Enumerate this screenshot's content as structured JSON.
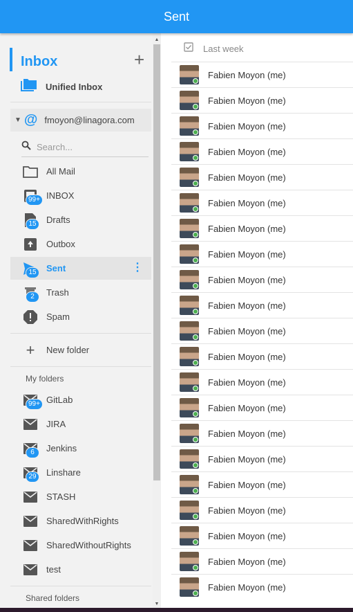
{
  "header": {
    "title": "Sent"
  },
  "sidebar": {
    "inbox_title": "Inbox",
    "unified_label": "Unified Inbox",
    "account_email": "fmoyon@linagora.com",
    "search_placeholder": "Search...",
    "folders": [
      {
        "label": "All Mail",
        "icon": "folder-icon",
        "badge": ""
      },
      {
        "label": "INBOX",
        "icon": "inbox-icon",
        "badge": "99+"
      },
      {
        "label": "Drafts",
        "icon": "drafts-icon",
        "badge": "15"
      },
      {
        "label": "Outbox",
        "icon": "outbox-icon",
        "badge": ""
      },
      {
        "label": "Sent",
        "icon": "send-icon",
        "badge": "15",
        "active": true
      },
      {
        "label": "Trash",
        "icon": "trash-icon",
        "badge": "2"
      },
      {
        "label": "Spam",
        "icon": "spam-icon",
        "badge": ""
      }
    ],
    "new_folder_label": "New folder",
    "my_folders_label": "My folders",
    "my_folders": [
      {
        "label": "GitLab",
        "badge": "99+"
      },
      {
        "label": "JIRA",
        "badge": ""
      },
      {
        "label": "Jenkins",
        "badge": "6"
      },
      {
        "label": "Linshare",
        "badge": "29"
      },
      {
        "label": "STASH",
        "badge": ""
      },
      {
        "label": "SharedWithRights",
        "badge": ""
      },
      {
        "label": "SharedWithoutRights",
        "badge": ""
      },
      {
        "label": "test",
        "badge": ""
      }
    ],
    "shared_folders_label": "Shared folders"
  },
  "main": {
    "group_label": "Last week",
    "messages": [
      {
        "sender": "Fabien Moyon (me)"
      },
      {
        "sender": "Fabien Moyon (me)"
      },
      {
        "sender": "Fabien Moyon (me)"
      },
      {
        "sender": "Fabien Moyon (me)"
      },
      {
        "sender": "Fabien Moyon (me)"
      },
      {
        "sender": "Fabien Moyon (me)"
      },
      {
        "sender": "Fabien Moyon (me)"
      },
      {
        "sender": "Fabien Moyon (me)"
      },
      {
        "sender": "Fabien Moyon (me)"
      },
      {
        "sender": "Fabien Moyon (me)"
      },
      {
        "sender": "Fabien Moyon (me)"
      },
      {
        "sender": "Fabien Moyon (me)"
      },
      {
        "sender": "Fabien Moyon (me)"
      },
      {
        "sender": "Fabien Moyon (me)"
      },
      {
        "sender": "Fabien Moyon (me)"
      },
      {
        "sender": "Fabien Moyon (me)"
      },
      {
        "sender": "Fabien Moyon (me)"
      },
      {
        "sender": "Fabien Moyon (me)"
      },
      {
        "sender": "Fabien Moyon (me)"
      },
      {
        "sender": "Fabien Moyon (me)"
      },
      {
        "sender": "Fabien Moyon (me)"
      }
    ]
  },
  "colors": {
    "accent": "#2196f3",
    "online": "#4caf50"
  }
}
